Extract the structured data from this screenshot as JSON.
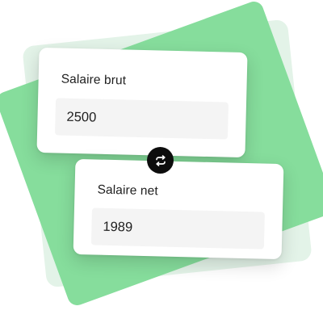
{
  "converter": {
    "gross": {
      "label": "Salaire brut",
      "value": "2500"
    },
    "net": {
      "label": "Salaire net",
      "value": "1989"
    },
    "swap_icon": "swap-arrows-icon"
  },
  "colors": {
    "green_accent": "#86dd9c",
    "light_green": "#e3f3e8",
    "field_background": "#f4f4f4",
    "swap_button": "#0d0d0d"
  }
}
